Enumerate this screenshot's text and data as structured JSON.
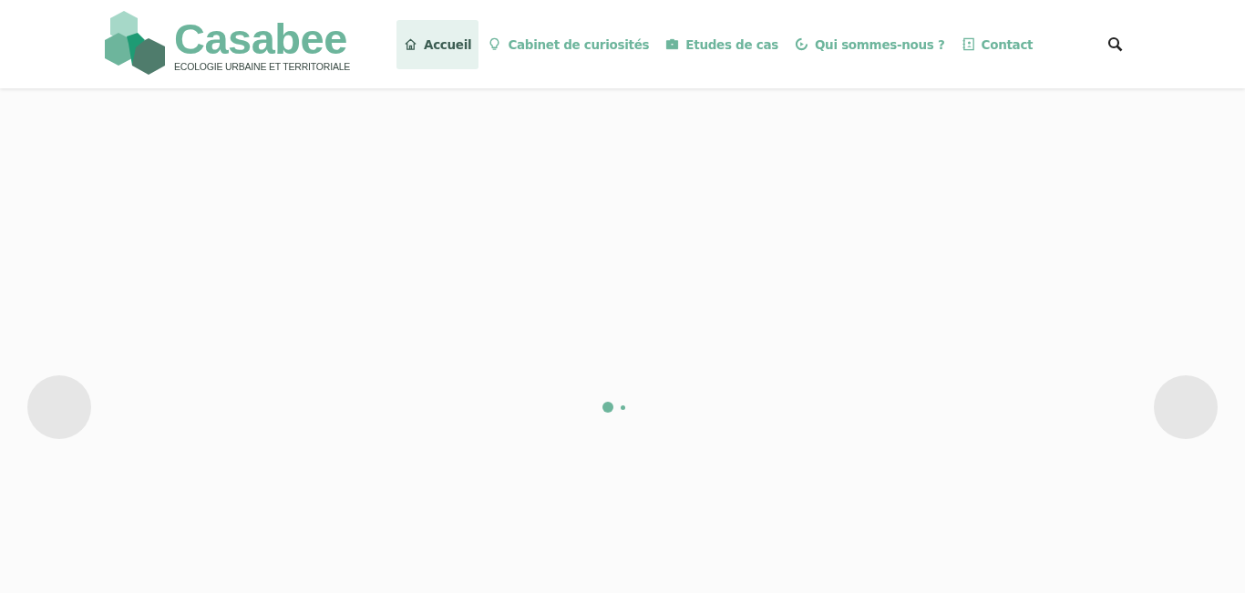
{
  "logo": {
    "name": "Casabee",
    "tagline": "ECOLOGIE URBAINE ET TERRITORIALE"
  },
  "nav": [
    {
      "label": "Accueil",
      "selected": true
    },
    {
      "label": "Cabinet de curiosités",
      "selected": false
    },
    {
      "label": "Etudes de cas",
      "selected": false
    },
    {
      "label": "Qui sommes-nous ?",
      "selected": false
    },
    {
      "label": "Contact",
      "selected": false
    }
  ],
  "slider": {
    "dots": [
      {
        "selected": true
      },
      {
        "selected": false
      }
    ]
  }
}
